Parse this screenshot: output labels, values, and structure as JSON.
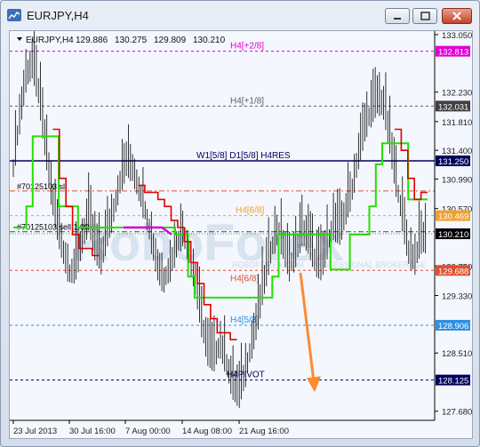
{
  "window": {
    "title": "EURJPY,H4",
    "buttons": [
      "minimize",
      "restore",
      "close"
    ]
  },
  "chart_header": {
    "symbol": "EURJPY,H4",
    "open": "129.886",
    "high": "130.275",
    "low": "129.809",
    "close": "130.210"
  },
  "chart_data": {
    "type": "line",
    "price_scale": {
      "ticks": [
        "133.050",
        "132.230",
        "131.810",
        "131.400",
        "130.990",
        "130.570",
        "129.750",
        "129.330",
        "128.510",
        "127.680"
      ],
      "ylim": [
        127.55,
        133.1
      ]
    },
    "time_scale": {
      "ticks": [
        "23 Jul 2013",
        "30 Jul 16:00",
        "7 Aug 00:00",
        "14 Aug 08:00",
        "21 Aug 16:00"
      ]
    },
    "levels": [
      {
        "label": "H4[+2/8]",
        "price": "132.813",
        "value": 132.813,
        "color": "#e000d0",
        "badge": "#e000d0"
      },
      {
        "label": "H4[+1/8]",
        "price": "132.031",
        "value": 132.031,
        "color": "#606060",
        "badge": "#404040"
      },
      {
        "label": "W1[5/8] D1[5/8] H4RES",
        "price": "131.250",
        "value": 131.25,
        "color": "#000060",
        "badge": "#000060"
      },
      {
        "label": "H4[6/8]",
        "price": "130.469",
        "value": 130.469,
        "color": "#f0a030",
        "badge": "#f0a030"
      },
      {
        "label": "H4[6/8]",
        "price": "129.688",
        "value": 129.688,
        "color": "#e05030",
        "badge": "#e05030"
      },
      {
        "label": "H4[5/8]",
        "price": "128.906",
        "value": 128.906,
        "color": "#3090e0",
        "badge": "#3090e0"
      },
      {
        "label": "H4PIVOT",
        "price": "128.125",
        "value": 128.125,
        "color": "#000060",
        "badge": "#000060"
      }
    ],
    "current_price": {
      "price": "130.210",
      "value": 130.21
    },
    "order_lines": [
      {
        "label": "#70125103 sl",
        "value": 130.82
      },
      {
        "label": "#70125103 sell 1.00",
        "value": 130.24
      }
    ],
    "watermark": "RoboForex",
    "watermark_sub": "ROBOFOREX.COM  ·  PROFESSIONAL BROKERAGE",
    "close_series": [
      131.2,
      131.9,
      132.5,
      132.7,
      132.3,
      131.6,
      130.9,
      130.4,
      130.0,
      129.7,
      129.8,
      130.2,
      130.5,
      130.1,
      129.9,
      130.3,
      130.6,
      131.0,
      131.3,
      131.2,
      130.9,
      130.6,
      130.2,
      129.8,
      129.6,
      129.8,
      130.1,
      130.3,
      130.0,
      129.6,
      129.0,
      128.6,
      128.5,
      128.7,
      128.4,
      128.1,
      128.0,
      128.3,
      128.7,
      129.1,
      129.6,
      130.0,
      130.3,
      130.1,
      129.8,
      130.0,
      130.3,
      130.2,
      129.9,
      129.8,
      130.1,
      130.4,
      130.3,
      130.6,
      130.9,
      131.4,
      131.8,
      132.0,
      132.2,
      132.1,
      131.6,
      131.0,
      130.5,
      130.0,
      129.9,
      130.2
    ],
    "green_line": [
      130.3,
      130.3,
      130.6,
      131.6,
      131.6,
      131.6,
      131.6,
      130.6,
      130.6,
      130.6,
      130.3,
      130.3,
      130.3,
      130.3,
      130.3,
      130.3,
      130.3,
      130.3,
      130.3,
      130.3,
      130.3,
      130.3,
      130.3,
      130.3,
      130.3,
      130.2,
      130.2,
      129.6,
      129.3,
      129.3,
      129.3,
      129.3,
      129.3,
      129.3,
      129.3,
      129.3,
      129.3,
      129.3,
      129.3,
      129.3,
      129.6,
      130.2,
      130.2,
      130.2,
      130.2,
      130.2,
      130.2,
      130.2,
      130.2,
      129.7,
      129.7,
      129.7,
      130.2,
      130.2,
      130.2,
      130.6,
      131.2,
      131.5,
      131.5,
      131.5,
      131.5,
      130.7,
      130.7,
      130.7
    ],
    "red_line": [
      null,
      null,
      null,
      null,
      null,
      null,
      131.7,
      131.0,
      130.6,
      130.2,
      130.0,
      130.0,
      129.9,
      null,
      null,
      null,
      null,
      null,
      null,
      130.9,
      130.8,
      130.8,
      130.7,
      130.6,
      130.4,
      130.3,
      130.1,
      129.8,
      129.5,
      129.2,
      129.0,
      128.8,
      128.8,
      128.7,
      null,
      null,
      null,
      null,
      null,
      null,
      null,
      null,
      null,
      null,
      null,
      null,
      null,
      null,
      null,
      null,
      null,
      null,
      null,
      null,
      null,
      null,
      null,
      null,
      131.7,
      131.4,
      131.0,
      130.7,
      130.8
    ],
    "magenta_segment": [
      130.3,
      130.3,
      130.3,
      130.3,
      130.3,
      130.2
    ],
    "forecast_arrow": {
      "from": 129.68,
      "to": 127.95,
      "color": "#ff8a30"
    }
  },
  "colors": {
    "bars": "#000000",
    "green": "#22e000",
    "red": "#e00000",
    "magenta": "#d000d0",
    "axis_text": "#222222",
    "current_price_badge": "#000000"
  }
}
